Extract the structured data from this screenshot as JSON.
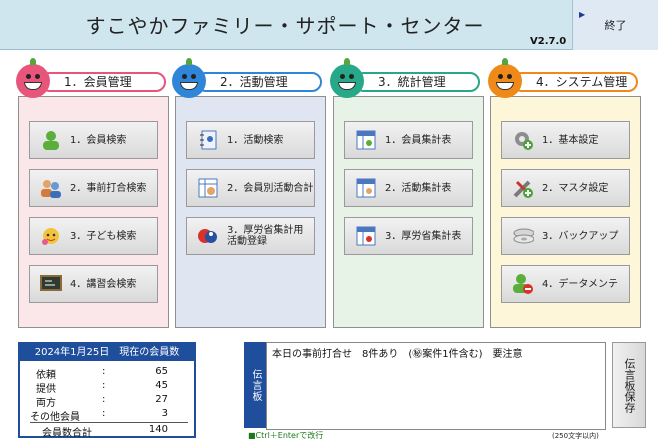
{
  "header": {
    "title": "すこやかファミリー・サポート・センター",
    "version": "V2.7.0",
    "exit_label": "終了"
  },
  "sections": [
    {
      "title": "1．会員管理",
      "color": "#e8557a",
      "buttons": [
        {
          "label": "1．会員検索",
          "icon": "user-search-icon"
        },
        {
          "label": "2．事前打合検索",
          "icon": "people-meeting-icon"
        },
        {
          "label": "3．子ども検索",
          "icon": "child-icon"
        },
        {
          "label": "4．講習会検索",
          "icon": "blackboard-icon"
        }
      ]
    },
    {
      "title": "2．活動管理",
      "color": "#2f86d9",
      "buttons": [
        {
          "label": "1．活動検索",
          "icon": "notebook-icon"
        },
        {
          "label": "2．会員別活動合計",
          "icon": "member-table-icon"
        },
        {
          "label": "3．厚労省集計用活動登録",
          "icon": "register-icon"
        }
      ]
    },
    {
      "title": "3．統計管理",
      "color": "#27a889",
      "buttons": [
        {
          "label": "1．会員集計表",
          "icon": "member-sheet-icon"
        },
        {
          "label": "2．活動集計表",
          "icon": "activity-sheet-icon"
        },
        {
          "label": "3．厚労省集計表",
          "icon": "ministry-sheet-icon"
        }
      ]
    },
    {
      "title": "4．システム管理",
      "color": "#ef8a1a",
      "buttons": [
        {
          "label": "1．基本設定",
          "icon": "gear-icon"
        },
        {
          "label": "2．マスタ設定",
          "icon": "tools-icon"
        },
        {
          "label": "3．バックアップ",
          "icon": "disk-icon"
        },
        {
          "label": "4．データメンテ",
          "icon": "user-remove-icon"
        }
      ]
    }
  ],
  "stats": {
    "header": "2024年1月25日　現在の会員数",
    "rows": [
      {
        "label": "依頼",
        "value": "65"
      },
      {
        "label": "提供",
        "value": "45"
      },
      {
        "label": "両方",
        "value": "27"
      },
      {
        "label": "その他会員",
        "value": "3"
      }
    ],
    "total_label": "会員数合計",
    "total_value": "140",
    "colon": ":"
  },
  "board": {
    "tab_label": "伝言板",
    "text": "本日の事前打合せ　8件あり　(㊙案件1件含む)　要注意",
    "hint": "■Ctrl＋Enterで改行",
    "count": "(250文字以内)",
    "save_label": "伝言板保存"
  }
}
